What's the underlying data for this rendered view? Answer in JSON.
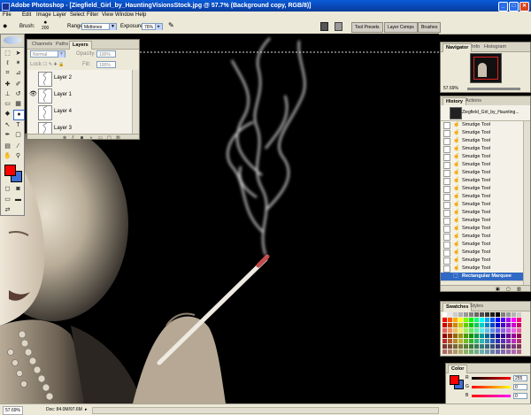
{
  "titlebar": {
    "title": "Adobe Photoshop - [Ziegfield_Girl_by_HauntingVisionsStock.jpg @ 57.7% (Background copy, RGB/8)]",
    "minimize": "_",
    "maximize": "□",
    "close": "✕"
  },
  "menu": [
    "File",
    "Edit",
    "Image",
    "Layer",
    "Select",
    "Filter",
    "View",
    "Window",
    "Help"
  ],
  "options": {
    "brush_label": "Brush:",
    "brush_size": "200",
    "range_label": "Range:",
    "range_value": "Midtones",
    "exposure_label": "Exposure:",
    "exposure_value": "76%",
    "wells": [
      "Tool Presets",
      "Layer Comps",
      "Brushes"
    ]
  },
  "layers_panel": {
    "tabs": [
      "Channels",
      "Paths",
      "Layers"
    ],
    "blend_mode": "Normal",
    "opacity_label": "Opacity:",
    "opacity_value": "100%",
    "lock_label": "Lock:",
    "fill_label": "Fill:",
    "fill_value": "100%",
    "layers": [
      {
        "name": "Layer 2",
        "visible": false
      },
      {
        "name": "Layer 1",
        "visible": true
      },
      {
        "name": "Layer 4",
        "visible": false
      },
      {
        "name": "Layer 3",
        "visible": false
      }
    ]
  },
  "navigator": {
    "tabs": [
      "Navigator",
      "Info",
      "Histogram"
    ],
    "zoom": "57.69%"
  },
  "history": {
    "tabs": [
      "History",
      "Actions"
    ],
    "snapshot": "Ziegfield_Girl_by_Haunting...",
    "items": [
      "Smudge Tool",
      "Smudge Tool",
      "Smudge Tool",
      "Smudge Tool",
      "Smudge Tool",
      "Smudge Tool",
      "Smudge Tool",
      "Smudge Tool",
      "Smudge Tool",
      "Smudge Tool",
      "Smudge Tool",
      "Smudge Tool",
      "Smudge Tool",
      "Smudge Tool",
      "Smudge Tool",
      "Smudge Tool",
      "Smudge Tool",
      "Smudge Tool",
      "Smudge Tool"
    ],
    "selected": "Rectangular Marquee"
  },
  "swatches": {
    "tabs": [
      "Swatches",
      "Styles"
    ]
  },
  "color_panel": {
    "tab": "Color",
    "channels": [
      {
        "label": "R",
        "value": "255",
        "color": "#ff0000"
      },
      {
        "label": "G",
        "value": "0",
        "color": "#00aa00"
      },
      {
        "label": "B",
        "value": "0",
        "color": "#0000ff"
      }
    ]
  },
  "status": {
    "zoom": "57.69%",
    "doc": "Doc: 84.0M/97.6M"
  },
  "colors": {
    "foreground": "#ff0000",
    "background": "#3d6fd6",
    "accent": "#316ac5"
  }
}
